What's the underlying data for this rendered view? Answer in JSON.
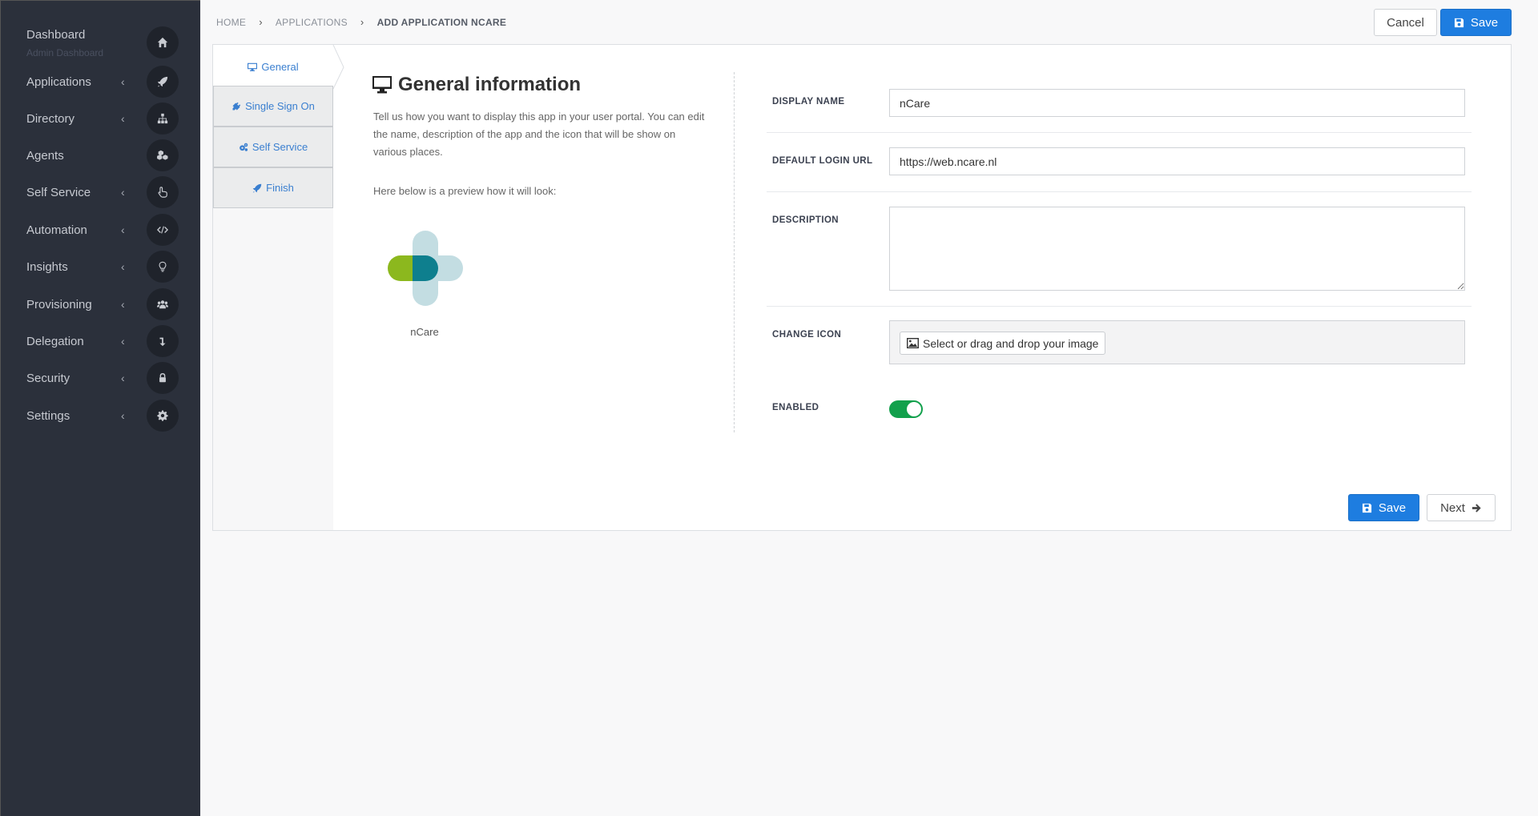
{
  "sidebar": {
    "items": [
      {
        "label": "Dashboard",
        "sub": "Admin Dashboard",
        "icon": "home-icon"
      },
      {
        "label": "Applications",
        "icon": "rocket-icon"
      },
      {
        "label": "Directory",
        "icon": "sitemap-icon"
      },
      {
        "label": "Agents",
        "icon": "cubes-icon"
      },
      {
        "label": "Self Service",
        "icon": "hand-pointer-icon"
      },
      {
        "label": "Automation",
        "icon": "code-icon"
      },
      {
        "label": "Insights",
        "icon": "lightbulb-icon"
      },
      {
        "label": "Provisioning",
        "icon": "users-icon"
      },
      {
        "label": "Delegation",
        "icon": "level-down-icon"
      },
      {
        "label": "Security",
        "icon": "lock-icon"
      },
      {
        "label": "Settings",
        "icon": "gear-icon"
      }
    ],
    "chevron": "‹"
  },
  "breadcrumb": {
    "items": [
      "HOME",
      "APPLICATIONS",
      "ADD APPLICATION NCARE"
    ],
    "separator": "›"
  },
  "header": {
    "cancel_label": "Cancel",
    "save_label": "Save"
  },
  "tabs": [
    {
      "label": "General"
    },
    {
      "label": "Single Sign On"
    },
    {
      "label": "Self Service"
    },
    {
      "label": "Finish"
    }
  ],
  "general": {
    "title": "General information",
    "description": "Tell us how you want to display this app in your user portal. You can edit the name, description of the app and the icon that will be show on various places.",
    "preview_note": "Here below is a preview how it will look:",
    "app_name": "nCare",
    "logo_colors": {
      "green": "#8cb81e",
      "teal": "#0e7f8e",
      "light": "#c3dde2"
    }
  },
  "form": {
    "display_name": {
      "label": "DISPLAY NAME",
      "value": "nCare"
    },
    "default_login_url": {
      "label": "DEFAULT LOGIN URL",
      "value": "https://web.ncare.nl"
    },
    "description": {
      "label": "DESCRIPTION",
      "value": ""
    },
    "change_icon": {
      "label": "CHANGE ICON",
      "button_label": "Select or drag and drop your image"
    },
    "enabled": {
      "label": "ENABLED",
      "value": true
    }
  },
  "footer": {
    "save_label": "Save",
    "next_label": "Next"
  },
  "colors": {
    "sidebar_bg": "#2b303b",
    "primary": "#1e7de0",
    "toggle_on": "#12a04c"
  }
}
